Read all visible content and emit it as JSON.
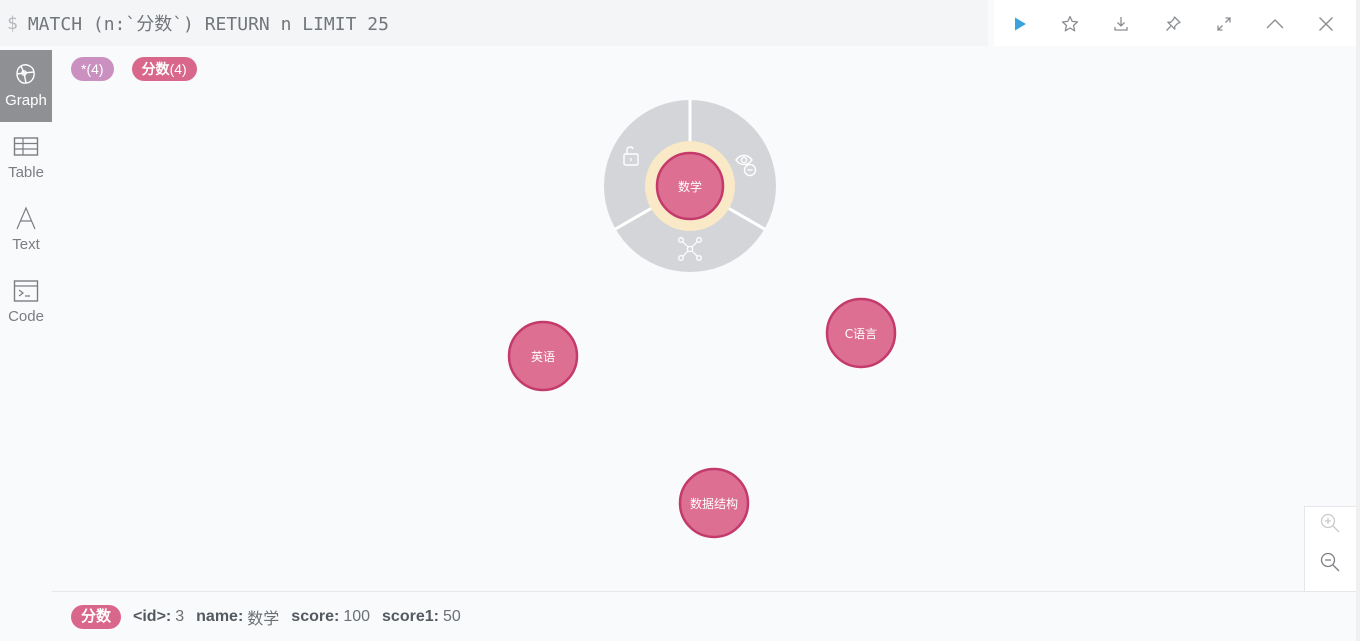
{
  "query": {
    "prompt": "$",
    "text": "MATCH (n:`分数`) RETURN n LIMIT 25"
  },
  "toolbar": {
    "icons": [
      "play-icon",
      "star-icon",
      "download-icon",
      "pin-icon",
      "expand-icon",
      "collapse-icon",
      "close-icon"
    ],
    "run_color": "#3ba2e0"
  },
  "rail": {
    "items": [
      {
        "label": "Graph",
        "icon": "graph-icon",
        "active": true
      },
      {
        "label": "Table",
        "icon": "table-icon",
        "active": false
      },
      {
        "label": "Text",
        "icon": "text-icon",
        "active": false
      },
      {
        "label": "Code",
        "icon": "code-icon",
        "active": false
      }
    ]
  },
  "legend": {
    "all_label": "*(4)",
    "label_name": "分数",
    "label_count": "(4)"
  },
  "graph": {
    "node_color": "#dd6f92",
    "node_stroke": "#c33a6b",
    "nodes": [
      {
        "id": 3,
        "name": "数学",
        "selected": true
      },
      {
        "name": "英语"
      },
      {
        "name": "C语言"
      },
      {
        "name": "数据结构"
      }
    ],
    "ring_icons": [
      "unlock-icon",
      "hide-icon",
      "expand-relationships-icon"
    ]
  },
  "status": {
    "label": "分数",
    "props": [
      {
        "key": "<id>:",
        "value": "3"
      },
      {
        "key": "name:",
        "value": "数学"
      },
      {
        "key": "score:",
        "value": "100"
      },
      {
        "key": "score1:",
        "value": "50"
      }
    ]
  },
  "zoom": {
    "icons": [
      "zoom-in-icon",
      "zoom-out-icon"
    ]
  }
}
